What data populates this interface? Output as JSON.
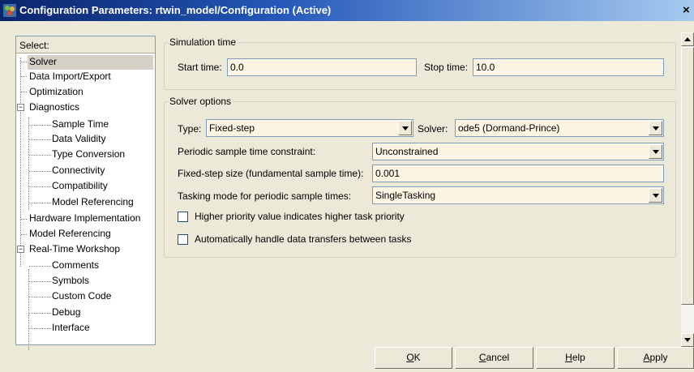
{
  "window": {
    "title": "Configuration Parameters: rtwin_model/Configuration (Active)",
    "close_glyph": "×"
  },
  "tree": {
    "header": "Select:",
    "expanded_glyph": "−",
    "items": [
      {
        "label": "Solver"
      },
      {
        "label": "Data Import/Export"
      },
      {
        "label": "Optimization"
      },
      {
        "label": "Diagnostics"
      },
      {
        "label": "Sample Time"
      },
      {
        "label": "Data Validity"
      },
      {
        "label": "Type Conversion"
      },
      {
        "label": "Connectivity"
      },
      {
        "label": "Compatibility"
      },
      {
        "label": "Model Referencing"
      },
      {
        "label": "Hardware Implementation"
      },
      {
        "label": "Model Referencing"
      },
      {
        "label": "Real-Time Workshop"
      },
      {
        "label": "Comments"
      },
      {
        "label": "Symbols"
      },
      {
        "label": "Custom Code"
      },
      {
        "label": "Debug"
      },
      {
        "label": "Interface"
      }
    ]
  },
  "simulation_time": {
    "title": "Simulation time",
    "start_label": "Start time:",
    "start_value": "0.0",
    "stop_label": "Stop time:",
    "stop_value": "10.0"
  },
  "solver_options": {
    "title": "Solver options",
    "type_label": "Type:",
    "type_value": "Fixed-step",
    "solver_label": "Solver:",
    "solver_value": "ode5 (Dormand-Prince)",
    "periodic_label": "Periodic sample time constraint:",
    "periodic_value": "Unconstrained",
    "fixed_step_label": "Fixed-step size (fundamental sample time):",
    "fixed_step_value": "0.001",
    "tasking_label": "Tasking mode for periodic sample times:",
    "tasking_value": "SingleTasking",
    "priority_label": "Higher priority value indicates higher task priority",
    "priority_checked": false,
    "auto_handle_label": "Automatically handle data transfers between tasks",
    "auto_handle_checked": false
  },
  "buttons": {
    "ok_mnemonic": "O",
    "ok_rest": "K",
    "cancel_mnemonic": "C",
    "cancel_rest": "ancel",
    "help_mnemonic": "H",
    "help_rest": "elp",
    "apply_mnemonic": "A",
    "apply_rest": "pply"
  },
  "colors": {
    "titlebar_start": "#0a246a",
    "titlebar_end": "#a6caf0",
    "field_background": "#fdf4e3",
    "dialog_background": "#ece9d8"
  }
}
